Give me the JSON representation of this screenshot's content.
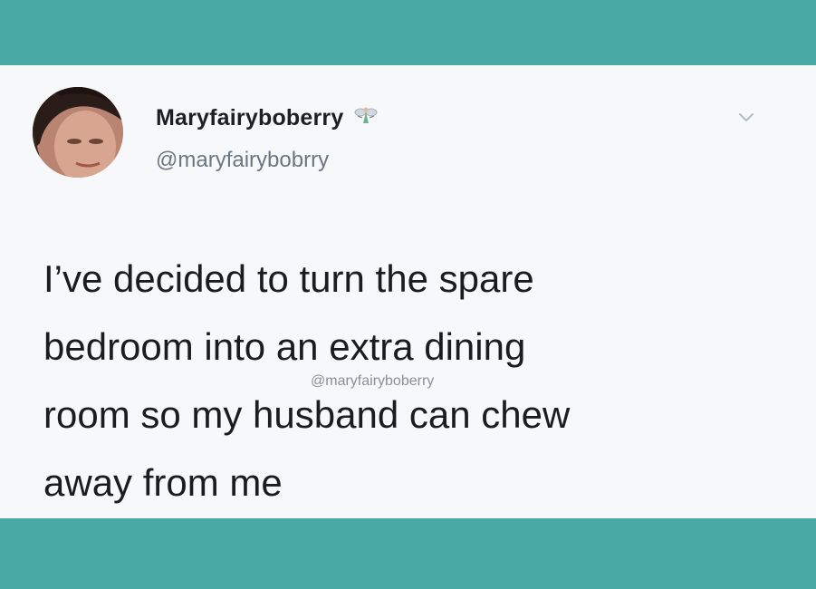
{
  "colors": {
    "frame_teal": "#4aaba6",
    "card_background": "#f7f8fa",
    "name_text": "#1c1f24",
    "handle_text": "#6b7682"
  },
  "tweet": {
    "display_name": "Maryfairyboberry",
    "name_emoji_icon": "fairy-icon",
    "handle": "@maryfairybobrry",
    "body": "I’ve decided to turn the spare\nbedroom into an extra dining\nroom so my husband can chew\naway from me",
    "menu_icon": "chevron-down-icon"
  },
  "watermark": "@maryfairyboberry"
}
